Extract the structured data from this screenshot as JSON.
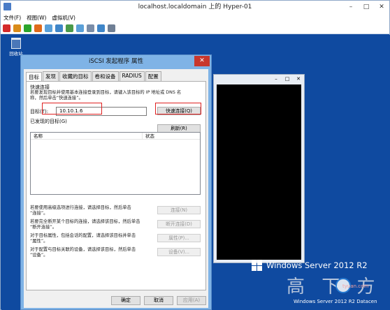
{
  "vm": {
    "title": "localhost.localdomain 上的 Hyper-01",
    "controls": [
      "–",
      "□",
      "✕"
    ],
    "menu": [
      "文件(F)",
      "视图(W)",
      "虚拟机(V)"
    ],
    "toolbar_icons": [
      "stop-icon",
      "pause-icon",
      "start-icon",
      "reset-icon",
      "snapshot-icon",
      "revert-icon",
      "back-icon",
      "forward-icon",
      "ctrl-alt-del-icon",
      "type-clipboard-icon",
      "enhanced-session-icon"
    ]
  },
  "desktop": {
    "recycle_bin_label": "回收站",
    "os_name": "Windows Server 2012 R2",
    "build_text": "Windows Server 2012 R2 Datacen",
    "background_color": "#0f4aa0"
  },
  "watermark": {
    "chars": "高 下 方",
    "site": "tyuan.com"
  },
  "bg_window": {
    "controls": [
      "–",
      "□",
      "✕"
    ]
  },
  "dialog": {
    "title": "iSCSI 发起程序 属性",
    "close_label": "✕",
    "tabs": [
      "目标",
      "发现",
      "收藏的目标",
      "卷和设备",
      "RADIUS",
      "配置"
    ],
    "active_tab": "目标",
    "quick_connect": {
      "heading": "快速连接",
      "desc1": "若要发现目标并使用基本连接登录到目标，请键入该目标的 IP 地址或 DNS 名",
      "desc2": "称，然后单击“快速连接”。",
      "target_label": "目标(T):",
      "target_value": "10.10.1.6",
      "button": "快速连接(Q)"
    },
    "discovered": {
      "heading": "已发现的目标(G)",
      "refresh_button": "刷新(R)",
      "columns": [
        "名称",
        "状态"
      ],
      "rows": []
    },
    "actions": [
      {
        "desc1": "若要使用高级选项进行连接，请选择目标，然后单击",
        "desc2": "“连接”。",
        "button": "连接(N)"
      },
      {
        "desc1": "若要完全断开某个目标的连接，请选择该目标，然后单击",
        "desc2": "“断开连接”。",
        "button": "断开连接(D)"
      },
      {
        "desc1": "对于目标属性，包括会话的配置，请选择该目标并单击",
        "desc2": "“属性”。",
        "button": "属性(P)..."
      },
      {
        "desc1": "对于配置与目标关联的设备，请选择该目标，然后单击",
        "desc2": "“设备”。",
        "button": "设备(V)..."
      }
    ],
    "footer": {
      "ok": "确定",
      "cancel": "取消",
      "apply": "应用(A)"
    }
  }
}
